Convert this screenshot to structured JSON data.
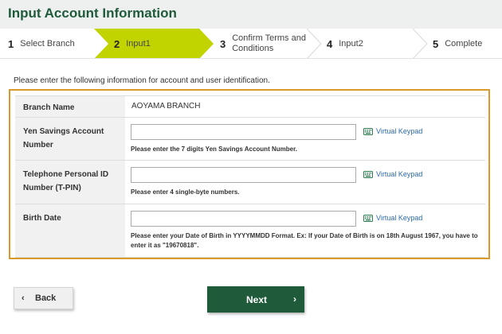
{
  "header": {
    "title": "Input Account Information"
  },
  "steps": [
    {
      "num": "1",
      "label": "Select Branch"
    },
    {
      "num": "2",
      "label": "Input1"
    },
    {
      "num": "3",
      "label_line1": "Confirm Terms and",
      "label_line2": "Conditions"
    },
    {
      "num": "4",
      "label": "Input2"
    },
    {
      "num": "5",
      "label": "Complete"
    }
  ],
  "intro": "Please enter the following information for account and user identification.",
  "form": {
    "branch": {
      "label": "Branch Name",
      "value": "AOYAMA BRANCH"
    },
    "account": {
      "label": "Yen Savings Account Number",
      "value": "",
      "keypad": "Virtual Keypad",
      "help": "Please enter the 7 digits Yen Savings Account Number."
    },
    "tpin": {
      "label": "Telephone Personal ID Number (T-PIN)",
      "value": "",
      "keypad": "Virtual Keypad",
      "help": "Please enter 4 single-byte numbers."
    },
    "birth": {
      "label": "Birth Date",
      "value": "",
      "keypad": "Virtual Keypad",
      "help": "Please enter your Date of Birth in YYYYMMDD Format. Ex: If your Date of Birth is on 18th August 1967, you have to enter it as \"19670818\"."
    }
  },
  "buttons": {
    "back": "Back",
    "next": "Next"
  },
  "icons": {
    "back": "chevron-left-icon",
    "next": "chevron-right-icon",
    "keypad": "keyboard-icon"
  },
  "colors": {
    "brand_green": "#1f5a3a",
    "active_step": "#c2d400",
    "form_border": "#d99a2b",
    "link_blue": "#2b6aa8"
  }
}
